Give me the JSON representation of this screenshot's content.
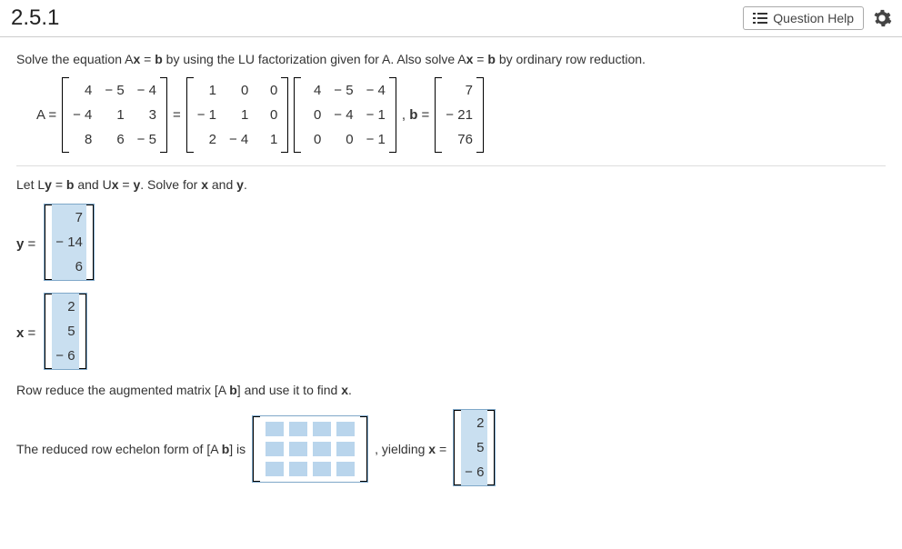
{
  "header": {
    "title": "2.5.1",
    "help_label": "Question Help"
  },
  "instruction": "Solve the equation Ax = b by using the LU factorization given for A. Also solve Ax = b by ordinary row reduction.",
  "equation": {
    "A_label": "A =",
    "A": [
      [
        "4",
        "− 5",
        "− 4"
      ],
      [
        "− 4",
        "1",
        "3"
      ],
      [
        "8",
        "6",
        "− 5"
      ]
    ],
    "eq": "=",
    "L": [
      [
        "1",
        "0",
        "0"
      ],
      [
        "− 1",
        "1",
        "0"
      ],
      [
        "2",
        "− 4",
        "1"
      ]
    ],
    "U": [
      [
        "4",
        "− 5",
        "− 4"
      ],
      [
        "0",
        "− 4",
        "− 1"
      ],
      [
        "0",
        "0",
        "− 1"
      ]
    ],
    "b_label": ", b =",
    "b": [
      [
        "7"
      ],
      [
        "− 21"
      ],
      [
        "76"
      ]
    ]
  },
  "step1_text": "Let Ly = b and Ux = y. Solve for x and y.",
  "y_label": "y =",
  "y_vec": [
    [
      "7"
    ],
    [
      "− 14"
    ],
    [
      "6"
    ]
  ],
  "x_label": "x =",
  "x_vec": [
    [
      "2"
    ],
    [
      "5"
    ],
    [
      "− 6"
    ]
  ],
  "step2_text": "Row reduce the augmented matrix [A b] and use it to find x.",
  "final": {
    "pre": "The reduced row echelon form of [A b] is",
    "mid": ", yielding x =",
    "x2": [
      [
        "2"
      ],
      [
        "5"
      ],
      [
        "− 6"
      ]
    ]
  }
}
